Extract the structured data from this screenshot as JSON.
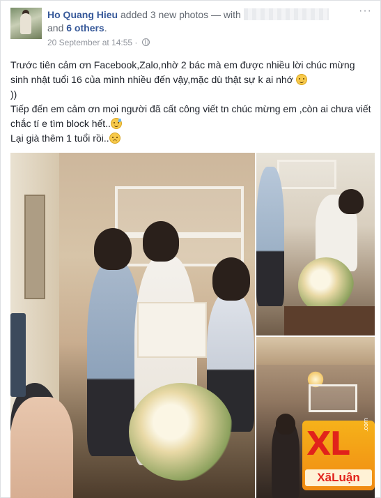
{
  "post": {
    "author": "Ho Quang Hieu",
    "action": " added 3 new photos — with ",
    "and_text": "and ",
    "others": "6 others",
    "others_suffix": ".",
    "timestamp": "20 September at 14:55",
    "timestamp_sep": " · ",
    "options": "···",
    "caption": {
      "line1": "Trước tiên cảm ơn Facebook,Zalo,nhờ 2 bác mà em được nhiều lời chúc mừng sinh nhật tuổi 16 của mình nhiều đến vậy,mặc dù thật sự k ai nhớ ",
      "line1_end": "))",
      "line2": "Tiếp đến em cảm ơn mọi người đã cất công viết tn chúc mừng em ,còn ai chưa viết chắc tí e tìm block hết..",
      "line3": "Lại già thêm 1 tuổi rồi.."
    },
    "emoji": [
      "slightly-smiling-face-icon",
      "grinning-sweat-face-icon",
      "tired-face-icon"
    ]
  },
  "watermark": {
    "main": "XL",
    "domain": ".com",
    "sub": "XãLuận"
  },
  "colors": {
    "link": "#365899",
    "meta": "#90949c",
    "watermark_red": "#e1221b",
    "watermark_orange": "#f39c12"
  }
}
